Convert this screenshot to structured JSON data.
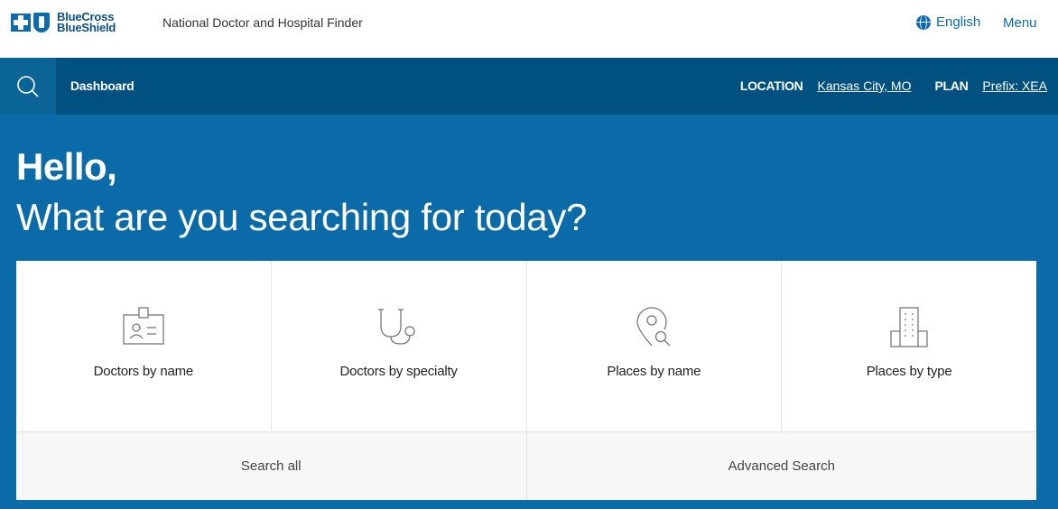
{
  "header": {
    "logo_text_line1": "BlueCross",
    "logo_text_line2": "BlueShield",
    "tagline": "National Doctor and Hospital Finder",
    "language": "English",
    "menu": "Menu"
  },
  "navbar": {
    "dashboard": "Dashboard",
    "location_label": "LOCATION",
    "location_value": "Kansas City, MO",
    "plan_label": "PLAN",
    "plan_value": "Prefix: XEA"
  },
  "hero": {
    "greeting": "Hello,",
    "question": "What are you searching for today?"
  },
  "tiles": [
    {
      "label": "Doctors by name",
      "icon": "id-card-icon"
    },
    {
      "label": "Doctors by specialty",
      "icon": "stethoscope-icon"
    },
    {
      "label": "Places by name",
      "icon": "location-search-icon"
    },
    {
      "label": "Places by type",
      "icon": "building-icon"
    }
  ],
  "actions": {
    "search_all": "Search all",
    "advanced_search": "Advanced Search"
  },
  "colors": {
    "navbar": "#005080",
    "hero": "#0a6ba8",
    "link": "#0a6bb0"
  }
}
